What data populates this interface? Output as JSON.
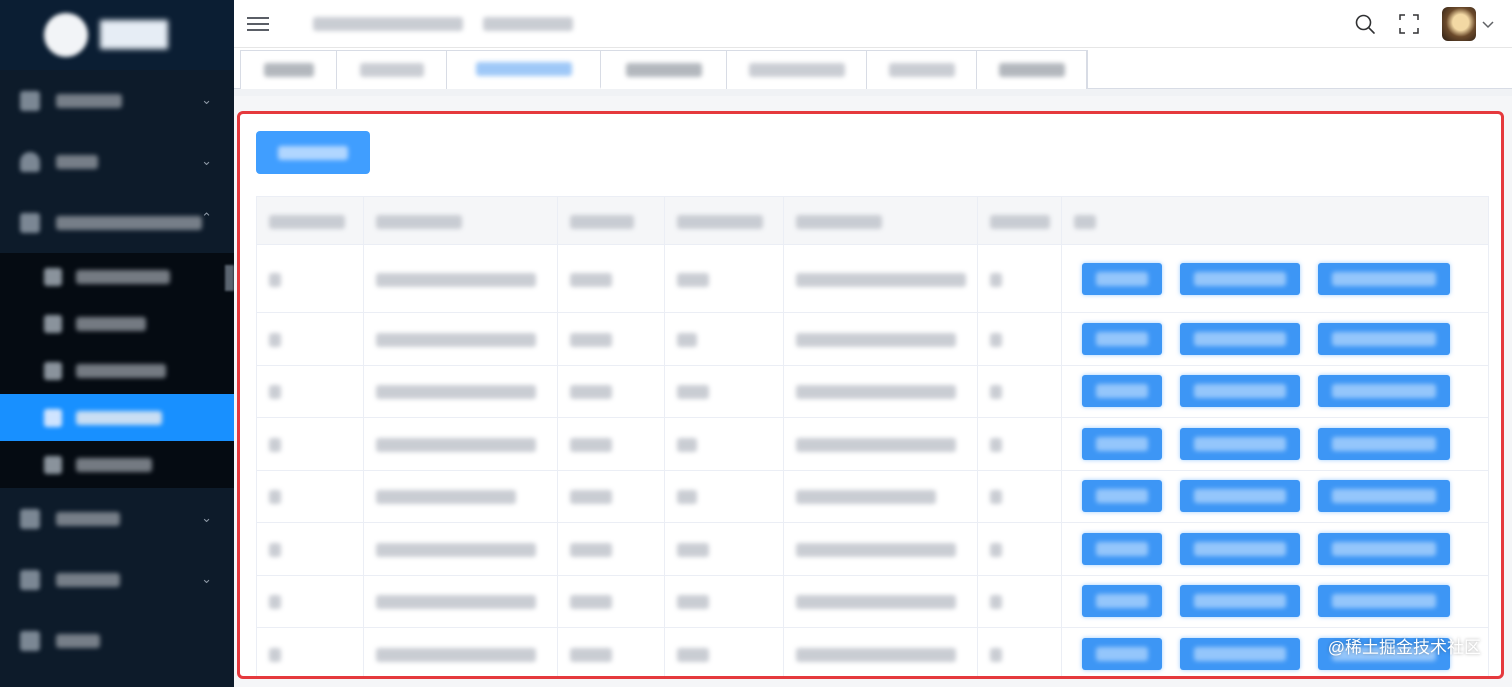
{
  "sidebar": {
    "logo_text": "████",
    "menu": [
      {
        "label": "████",
        "has_children": true,
        "expanded": false
      },
      {
        "label": "C██",
        "has_children": true,
        "expanded": false
      },
      {
        "label": "██████ ████",
        "has_children": true,
        "expanded": true
      }
    ],
    "submenu": [
      {
        "label": "█████",
        "active": false
      },
      {
        "label": "运████",
        "active": false
      },
      {
        "label": "█████",
        "active": false
      },
      {
        "label": "█████",
        "active": true
      },
      {
        "label": "████",
        "active": false
      }
    ],
    "menu_after": [
      {
        "label": "████",
        "has_children": true
      },
      {
        "label": "████",
        "has_children": true
      },
      {
        "label": "███",
        "has_children": false
      }
    ]
  },
  "header": {
    "breadcrumb": [
      "█████ █████",
      "█████理"
    ]
  },
  "tags": [
    {
      "label": "该█",
      "active": false
    },
    {
      "label": "█████",
      "active": false
    },
    {
      "label": "█████",
      "active": true
    },
    {
      "label": "███管理",
      "active": false
    },
    {
      "label": "██████",
      "active": false
    },
    {
      "label": "████",
      "active": false
    },
    {
      "label": "████理",
      "active": false
    }
  ],
  "toolbar": {
    "add_label": "█████"
  },
  "table": {
    "columns": [
      "██████",
      "██████",
      "█████",
      "██████",
      "██████",
      "█████",
      "操作"
    ],
    "rows": [
      [
        "█",
        "████████████ ███",
        "███",
        "██",
        "████████████ ███ t",
        "—",
        ""
      ],
      [
        "█",
        "██████████利 -",
        "███",
        "适",
        "██████████",
        "—",
        ""
      ],
      [
        "█",
        "██████████ ·",
        "███",
        "██",
        "██████████",
        "—",
        ""
      ],
      [
        "█",
        "██████████ 卜 t",
        "计 ]",
        "科",
        "██████████",
        "—",
        ""
      ],
      [
        "█",
        "████████",
        "██ ]",
        "Ε",
        "██████ ╼",
        "_",
        ""
      ],
      [
        "█",
        "██████████",
        "███",
        "██",
        "██████████",
        "—",
        ""
      ],
      [
        "█",
        "██████████",
        "███",
        "██",
        "██████████",
        "—",
        ""
      ],
      [
        "█",
        "██████ (█████) -",
        "███",
        "██",
        "████ ██ (█████)",
        "—",
        ""
      ]
    ],
    "row_ops": [
      "████",
      "██████",
      "███████"
    ]
  },
  "watermark": "@稀土掘金技术社区"
}
